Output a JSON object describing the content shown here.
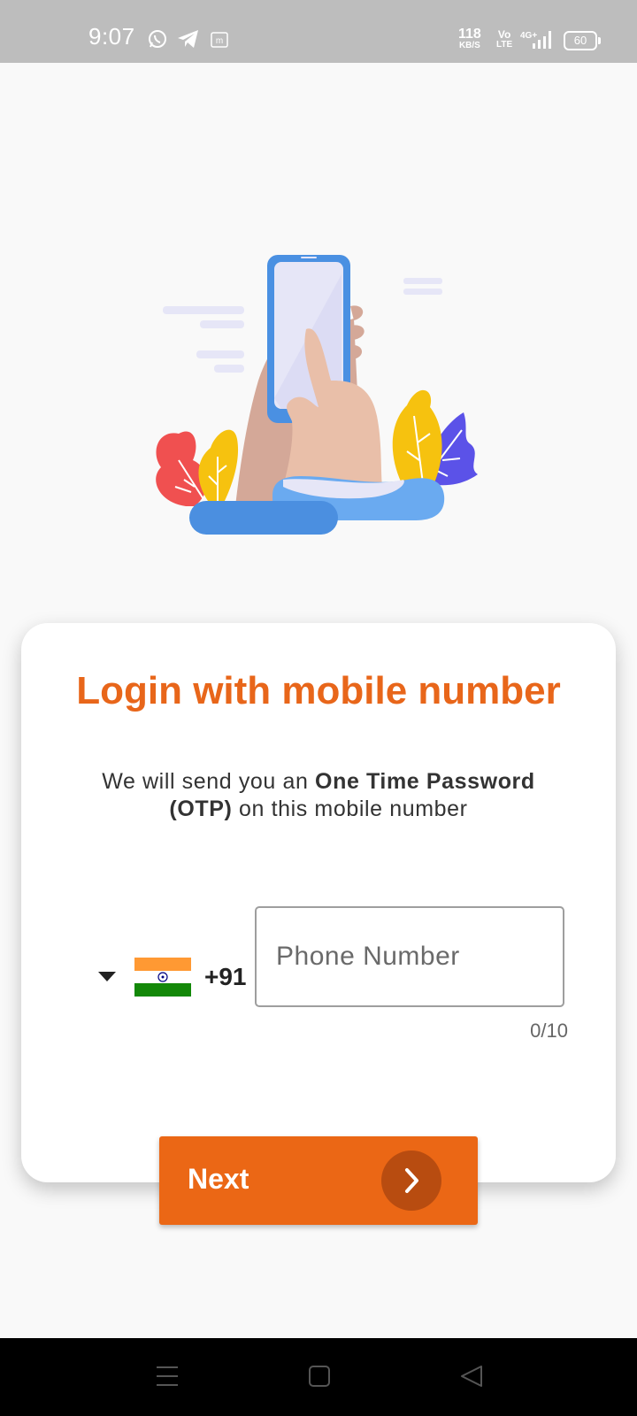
{
  "status_bar": {
    "time": "9:07",
    "net_speed_value": "118",
    "net_speed_unit": "KB/S",
    "volte_top": "Vo",
    "volte_bottom": "LTE",
    "network_type": "4G+",
    "battery_level": "60",
    "icons": [
      "whatsapp-icon",
      "telegram-icon",
      "m-notification-icon",
      "signal-icon",
      "battery-icon"
    ]
  },
  "illustration": {
    "description_icon": "hand-holding-phone-illustration",
    "colors": {
      "phone": "#4a90e2",
      "screen": "#e6e6f7",
      "hand_dark": "#d4a898",
      "hand_light": "#e9bfa9",
      "leaf_red": "#f05050",
      "leaf_yellow": "#f6c20f",
      "leaf_purple": "#5b52e8",
      "cloud": "#4b8fe0",
      "cloud_light": "#6aaaf0",
      "lines": "#e6e6f7"
    }
  },
  "login_card": {
    "title": "Login with mobile number",
    "desc_part1": "We will send you an ",
    "desc_bold": "One Time Password (OTP)",
    "desc_part2": " on this mobile number"
  },
  "country_picker": {
    "dial_code": "+91",
    "flag": "india-flag-icon",
    "arrow": "dropdown-arrow-icon"
  },
  "phone_input": {
    "value": "",
    "placeholder": "Phone Number",
    "counter": "0/10"
  },
  "next_button": {
    "label": "Next",
    "icon": "chevron-right-icon"
  },
  "nav_bar": {
    "icons": [
      "menu-icon",
      "home-icon",
      "back-icon"
    ]
  },
  "colors": {
    "accent": "#e8661a",
    "button": "#eb6715",
    "button_circle": "#b84c10",
    "status_bar": "#bdbdbd",
    "background": "#f9f9f9"
  }
}
